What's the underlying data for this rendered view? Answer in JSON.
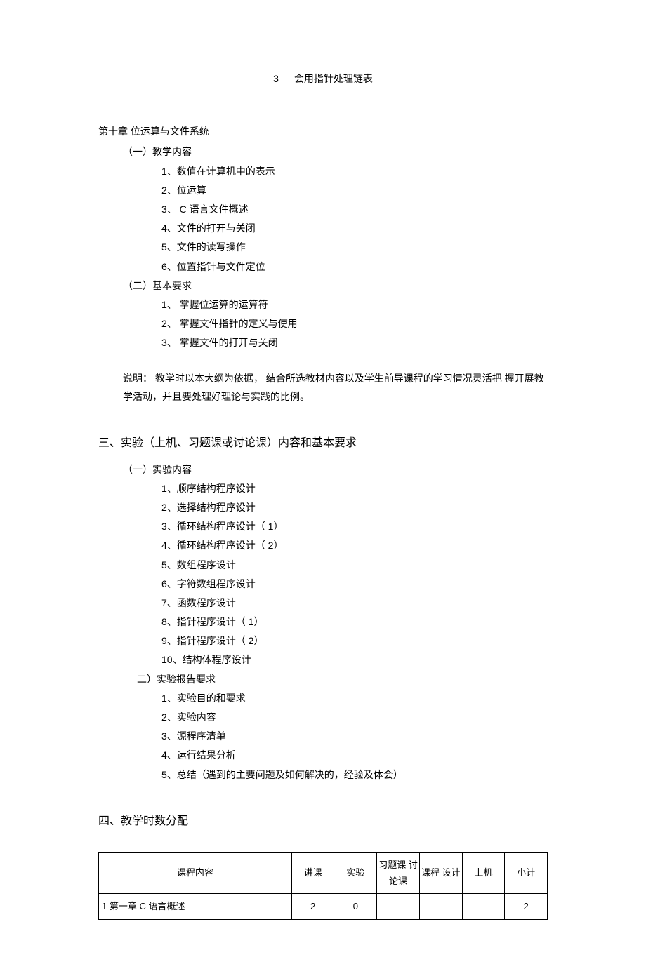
{
  "top": {
    "num": "3",
    "text": "会用指针处理链表"
  },
  "chapter10": {
    "title": "第十章 位运算与文件系统",
    "sub1": {
      "label": "（一）教学内容",
      "items": [
        "1、数值在计算机中的表示",
        "2、位运算",
        "3、 C 语言文件概述",
        "4、文件的打开与关闭",
        "5、文件的读写操作",
        "6、位置指针与文件定位"
      ]
    },
    "sub2": {
      "label": "（二）基本要求",
      "items": [
        "1、  掌握位运算的运算符",
        "2、  掌握文件指针的定义与使用",
        "3、    掌握文件的打开与关闭"
      ]
    }
  },
  "note": "说明：  教学时以本大纲为依据，  结合所选教材内容以及学生前导课程的学习情况灵活把  握开展教学活动，并且要处理好理论与实践的比例。",
  "section3": {
    "heading": "三、实验（上机、习题课或讨论课）内容和基本要求",
    "sub1": {
      "label": "（一）实验内容",
      "items": [
        "1、顺序结构程序设计",
        "2、选择结构程序设计",
        "3、循环结构程序设计（ 1）",
        "4、循环结构程序设计（ 2）",
        "5、数组程序设计",
        "6、字符数组程序设计",
        "7、函数程序设计",
        "8、指针程序设计（ 1）",
        "9、指针程序设计（ 2）",
        "10、结构体程序设计"
      ]
    },
    "sub2": {
      "label": "二）实验报告要求",
      "items": [
        "1、实验目的和要求",
        "2、实验内容",
        "3、源程序清单",
        "4、运行结果分析",
        "5、总结（遇到的主要问题及如何解决的，经验及体会）"
      ]
    }
  },
  "section4": {
    "heading": "四、教学时数分配",
    "headers": [
      "课程内容",
      "讲课",
      "实验",
      "习题课 讨论课",
      "课程 设计",
      "上机",
      "小计"
    ],
    "row1": {
      "c0": "1 第一章 C 语言概述",
      "c1": "2",
      "c2": "0",
      "c3": "",
      "c4": "",
      "c5": "",
      "c6": "2"
    }
  }
}
